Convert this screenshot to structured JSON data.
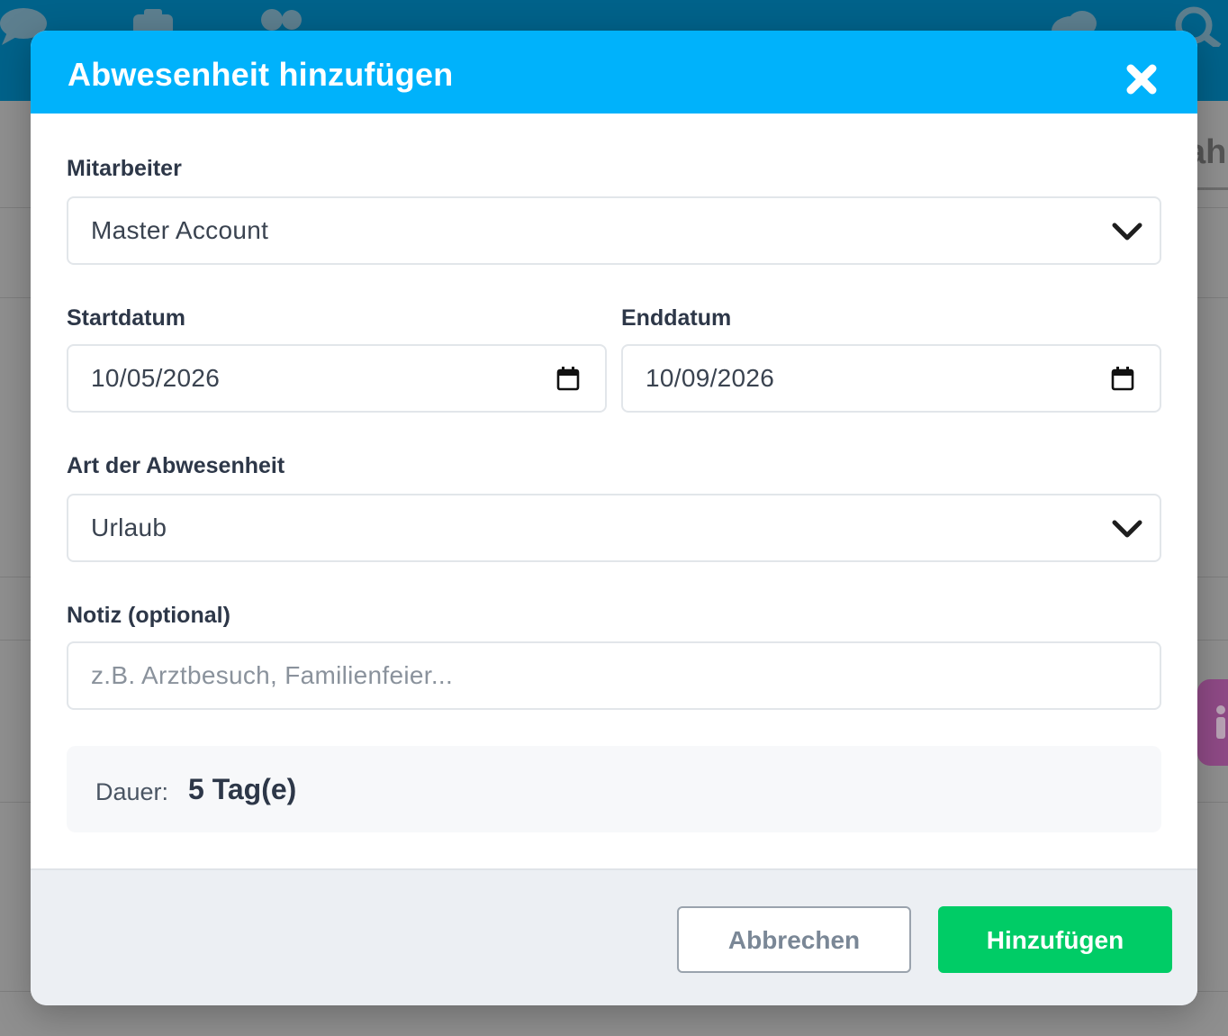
{
  "modal": {
    "title": "Abwesenheit hinzufügen"
  },
  "form": {
    "employee": {
      "label": "Mitarbeiter",
      "value": "Master Account"
    },
    "start_date": {
      "label": "Startdatum",
      "value": "10/05/2026"
    },
    "end_date": {
      "label": "Enddatum",
      "value": "10/09/2026"
    },
    "absence_type": {
      "label": "Art der Abwesenheit",
      "value": "Urlaub"
    },
    "note": {
      "label": "Notiz (optional)",
      "placeholder": "z.B. Arztbesuch, Familienfeier..."
    },
    "duration": {
      "label": "Dauer:",
      "value": "5 Tag(e)"
    }
  },
  "footer": {
    "cancel_label": "Abbrechen",
    "add_label": "Hinzufügen"
  },
  "background": {
    "side_text": "ahr"
  },
  "colors": {
    "header": "#00b2fb",
    "primary_button": "#00cc66",
    "topbar": "#00628a"
  },
  "icons": {
    "close": "close-icon",
    "dropdown": "chevron-down-icon",
    "date": "calendar-icon"
  }
}
